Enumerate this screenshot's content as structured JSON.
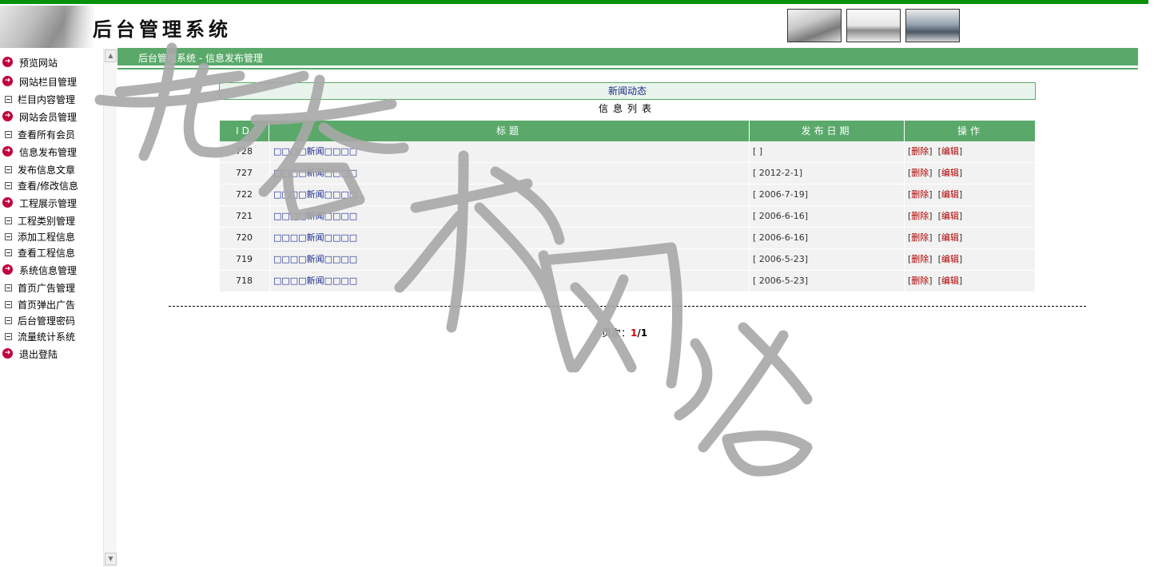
{
  "header": {
    "title": "后台管理系统"
  },
  "sidebar": {
    "items": [
      {
        "label": "预览网站",
        "type": "cat"
      },
      {
        "label": "网站栏目管理",
        "type": "cat"
      },
      {
        "label": "栏目内容管理",
        "type": "sub"
      },
      {
        "label": "网站会员管理",
        "type": "cat"
      },
      {
        "label": "查看所有会员",
        "type": "sub"
      },
      {
        "label": "信息发布管理",
        "type": "cat"
      },
      {
        "label": "发布信息文章",
        "type": "sub"
      },
      {
        "label": "查看/修改信息",
        "type": "sub"
      },
      {
        "label": "工程展示管理",
        "type": "cat"
      },
      {
        "label": "工程类别管理",
        "type": "sub"
      },
      {
        "label": "添加工程信息",
        "type": "sub"
      },
      {
        "label": "查看工程信息",
        "type": "sub"
      },
      {
        "label": "系统信息管理",
        "type": "cat"
      },
      {
        "label": "首页广告管理",
        "type": "sub"
      },
      {
        "label": "首页弹出广告",
        "type": "sub"
      },
      {
        "label": "后台管理密码",
        "type": "sub"
      },
      {
        "label": "流量统计系统",
        "type": "sub"
      },
      {
        "label": "退出登陆",
        "type": "cat"
      }
    ]
  },
  "breadcrumb": "后台管理系统 - 信息发布管理",
  "section_title": "新闻动态",
  "list_title": "信息列表",
  "table": {
    "headers": {
      "id": "ID",
      "title": "标题",
      "date": "发布日期",
      "ops": "操作"
    },
    "rows": [
      {
        "id": "728",
        "title": "□□□□新闻□□□□",
        "date": "[ ]"
      },
      {
        "id": "727",
        "title": "□□□□新闻□□□□",
        "date": "[ 2012-2-1]"
      },
      {
        "id": "722",
        "title": "□□□□新闻□□□□",
        "date": "[ 2006-7-19]"
      },
      {
        "id": "721",
        "title": "□□□□新闻□□□□",
        "date": "[ 2006-6-16]"
      },
      {
        "id": "720",
        "title": "□□□□新闻□□□□",
        "date": "[ 2006-6-16]"
      },
      {
        "id": "719",
        "title": "□□□□新闻□□□□",
        "date": "[ 2006-5-23]"
      },
      {
        "id": "718",
        "title": "□□□□新闻□□□□",
        "date": "[ 2006-5-23]"
      }
    ],
    "delete_label": "删除",
    "edit_label": "编辑"
  },
  "pager": {
    "prefix": "页次：",
    "current": "1",
    "total": "/1"
  },
  "watermark": "老杏树网络",
  "colors": {
    "topbar": "#0a8f0a",
    "green": "#5aa96a",
    "link_red": "#b00000",
    "link_blue": "#1a2b8c"
  },
  "icons": {
    "category_bullet": "arrow-circle-icon",
    "sub_bullet": "collapse-box-icon"
  }
}
